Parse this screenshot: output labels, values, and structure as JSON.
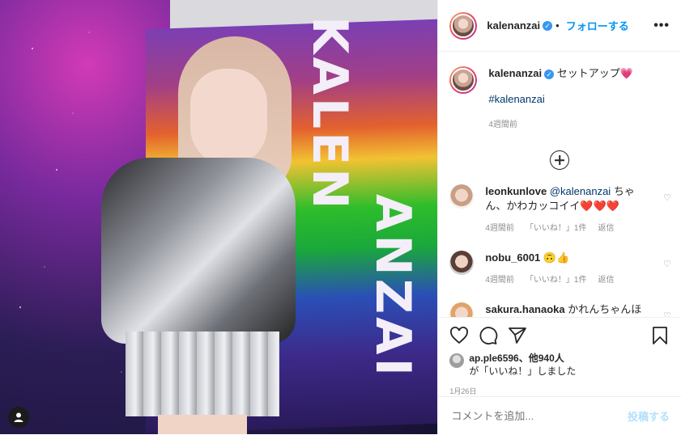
{
  "post": {
    "flag_text_1": "KALEN",
    "flag_text_2": "ANZAI"
  },
  "header": {
    "username": "kalenanzai",
    "dot": "•",
    "follow_label": "フォローする",
    "more_label": "•••"
  },
  "caption": {
    "username": "kalenanzai",
    "text": "セットアップ💗",
    "hashtag": "#kalenanzai",
    "time": "4週間前"
  },
  "comments": [
    {
      "username": "leonkunlove",
      "mention": "@kalenanzai",
      "text": " ちゃん、かわカッコイイ❤️❤️❤️",
      "time": "4週間前",
      "likes": "「いいね！」1件",
      "reply": "返信"
    },
    {
      "username": "nobu_6001",
      "text": "🙃👍",
      "time": "4週間前",
      "likes": "「いいね！」1件",
      "reply": "返信"
    },
    {
      "username": "sakura.hanaoka",
      "text": "かれんちゃんほん"
    }
  ],
  "likes": {
    "first_user": "ap.ple6596",
    "others": "、他940人",
    "suffix": "が「いいね！」しました"
  },
  "date": "1月26日",
  "add_comment": {
    "placeholder": "コメントを追加...",
    "post_label": "投稿する"
  },
  "colors": {
    "accent": "#0095f6",
    "link": "#00376b",
    "muted": "#8e8e8e"
  }
}
